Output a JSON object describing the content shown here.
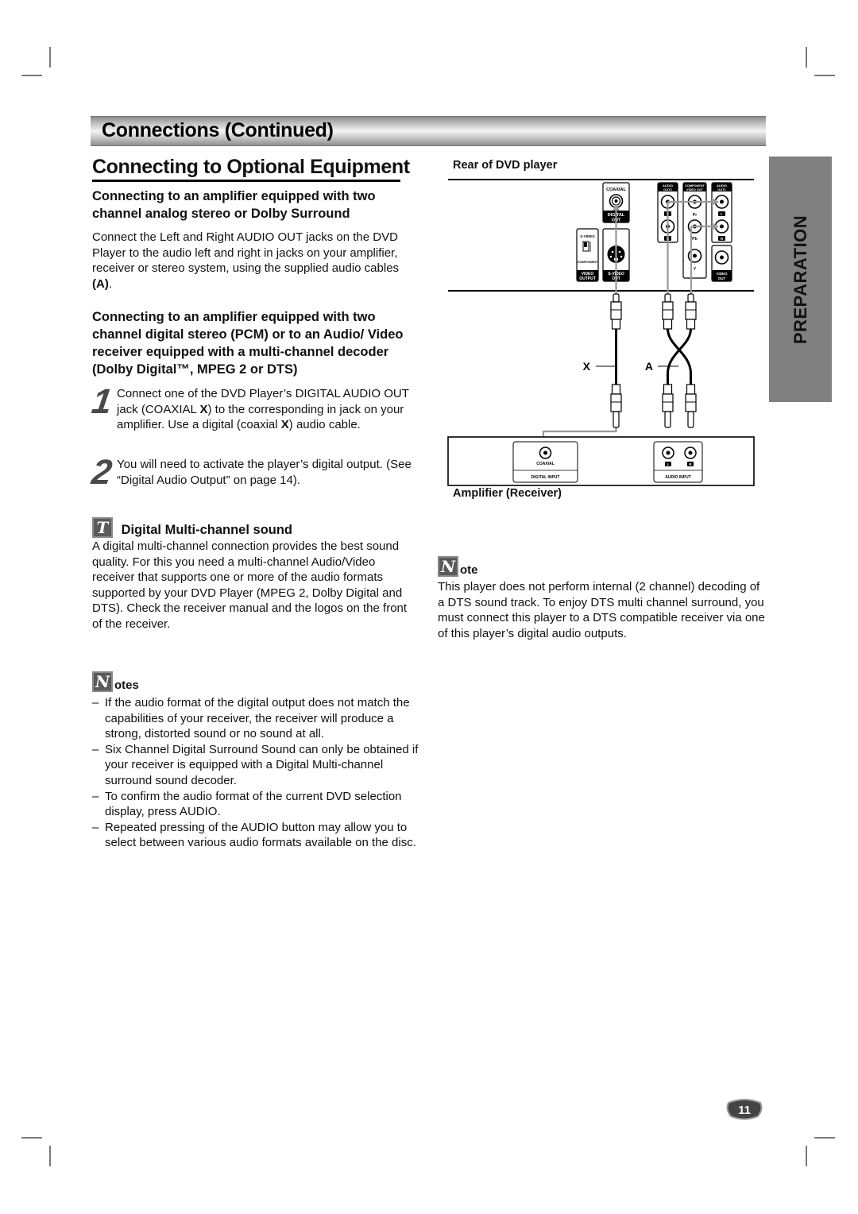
{
  "header": {
    "title": "Connections (Continued)"
  },
  "section": {
    "title": "Connecting to Optional Equipment"
  },
  "analog": {
    "heading": "Connecting to an amplifier equipped with two channel analog stereo or Dolby Surround",
    "body_pre": "Connect the Left and Right AUDIO OUT jacks on the DVD Player to the audio left and right in jacks on your amplifier, receiver or stereo system, using the supplied audio cables ",
    "body_bold": "(A)",
    "body_post": "."
  },
  "digital": {
    "heading": "Connecting to an amplifier equipped with two channel digital stereo (PCM) or to an Audio/ Video receiver equipped with a multi-channel decoder (Dolby Digital™, MPEG 2 or DTS)",
    "steps": [
      {
        "number": "1",
        "parts": [
          "Connect one of the DVD Player’s DIGITAL AUDIO OUT jack (COAXIAL ",
          "X",
          ") to the corresponding in jack on your amplifier. Use a digital (coaxial ",
          "X",
          ") audio cable."
        ]
      },
      {
        "number": "2",
        "parts": [
          "You will need to activate the player’s digital output. (See “Digital Audio Output” on page 14)."
        ]
      }
    ]
  },
  "tip": {
    "icon": "T",
    "title": "Digital Multi-channel sound",
    "body": "A digital multi-channel connection provides the best sound quality. For this you need a multi-channel Audio/Video receiver that supports one or more of the audio formats supported by your DVD Player (MPEG 2, Dolby Digital and DTS). Check the receiver manual and the logos on the front of the receiver."
  },
  "notes": {
    "icon": "N",
    "title": "otes",
    "items": [
      "If the audio format of the digital output does not match the capabilities of your receiver, the receiver will produce a strong, distorted sound or no sound at all.",
      "Six Channel Digital Surround Sound can only be obtained if your receiver is equipped with a Digital Multi-channel surround sound decoder.",
      "To confirm the audio format of the current DVD selection display, press AUDIO.",
      "Repeated pressing of the AUDIO button may allow you to select between various audio formats available on the disc."
    ]
  },
  "note": {
    "icon": "N",
    "title": "ote",
    "body": "This player does not perform internal (2 channel) decoding of a DTS sound track. To enjoy DTS multi channel surround, you must connect this player to a DTS compatible receiver via one of this player’s digital audio outputs."
  },
  "diagram": {
    "top_label": "Rear of DVD player",
    "bottom_label": "Amplifier (Receiver)",
    "cable_x": "X",
    "cable_a": "A",
    "player_panel": {
      "coaxial": "COAXIAL",
      "digital_out_1": "DIGITAL",
      "digital_out_2": "OUT",
      "svideo_switch_top": "S-VIDEO",
      "svideo_switch_bottom": "COMPONENT",
      "video_output_1": "VIDEO",
      "video_output_2": "OUTPUT",
      "svideo_out_1": "S-VIDEO",
      "svideo_out_2": "OUT",
      "audio_out2_1": "AUDIO",
      "audio_out2_2": "OUT2",
      "component_1": "COMPONENT",
      "component_2": "VIDEO OUT",
      "audio_out1_1": "AUDIO",
      "audio_out1_2": "OUT1",
      "jack_l": "L",
      "jack_r": "R",
      "pr": "Pr",
      "pb": "Pb",
      "y": "Y",
      "video_out_1": "VIDEO",
      "video_out_2": "OUT"
    },
    "amp_panel": {
      "coaxial": "COAXIAL",
      "digital_input": "DIGITAL INPUT",
      "audio_input": "AUDIO INPUT",
      "jack_l": "L",
      "jack_r": "R"
    }
  },
  "side_tab": {
    "label": "PREPARATION"
  },
  "page": {
    "number": "11"
  }
}
